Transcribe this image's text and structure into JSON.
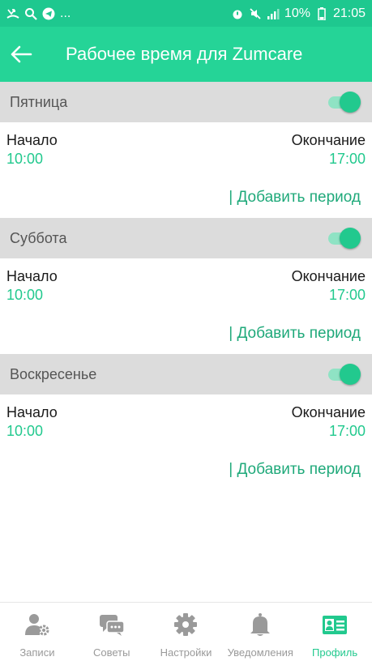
{
  "status_bar": {
    "left_text": "...",
    "battery": "10%",
    "time": "21:05"
  },
  "app_bar": {
    "title": "Рабочее время для Zumcare"
  },
  "labels": {
    "start": "Начало",
    "end": "Окончание",
    "add_period": "| Добавить период"
  },
  "days": [
    {
      "name": "Пятница",
      "enabled": true,
      "start": "10:00",
      "end": "17:00"
    },
    {
      "name": "Суббота",
      "enabled": true,
      "start": "10:00",
      "end": "17:00"
    },
    {
      "name": "Воскресенье",
      "enabled": true,
      "start": "10:00",
      "end": "17:00"
    }
  ],
  "bottom_nav": [
    {
      "label": "Записи",
      "icon": "user-gear-icon",
      "active": false
    },
    {
      "label": "Советы",
      "icon": "chat-bubbles-icon",
      "active": false
    },
    {
      "label": "Настройки",
      "icon": "gear-icon",
      "active": false
    },
    {
      "label": "Уведомления",
      "icon": "bell-icon",
      "active": false
    },
    {
      "label": "Профиль",
      "icon": "id-card-icon",
      "active": true
    }
  ],
  "colors": {
    "status_bar": "#1ec88f",
    "app_bar": "#25d497",
    "accent": "#22c98e",
    "day_header": "#dcdcdc"
  }
}
